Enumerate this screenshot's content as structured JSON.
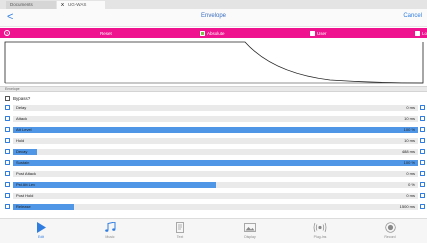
{
  "tabs": {
    "documents": "Documents",
    "active_close": "X",
    "active_label": "UG-WAS"
  },
  "navbar": {
    "back": "<",
    "title": "Envelope",
    "cancel": "Cancel"
  },
  "toolbar": {
    "help": "?",
    "reset": "Reset",
    "absolute": "Absolute",
    "user": "User",
    "extra": "Lo",
    "absolute_checked": true,
    "accent_color": "#f0138f"
  },
  "section_label": "Envelope",
  "bypass": {
    "label": "Bypass?",
    "checked": false
  },
  "params": [
    {
      "name": "Delay",
      "value": "0 ms",
      "fill": 0.0
    },
    {
      "name": "Attack",
      "value": "10 ms",
      "fill": 0.0
    },
    {
      "name": "Att Level",
      "value": "100 %",
      "fill": 1.0
    },
    {
      "name": "Hold",
      "value": "10 ms",
      "fill": 0.0
    },
    {
      "name": "Decay",
      "value": "488 ms",
      "fill": 0.06
    },
    {
      "name": "Sustain",
      "value": "100 %",
      "fill": 1.0
    },
    {
      "name": "Post Attack",
      "value": "0 ms",
      "fill": 0.0
    },
    {
      "name": "Pst Att Lev",
      "value": "0 %",
      "fill": 0.5
    },
    {
      "name": "Post Hold",
      "value": "0 ms",
      "fill": 0.0
    },
    {
      "name": "Release",
      "value": "1500 ms",
      "fill": 0.15
    }
  ],
  "tabbar": [
    {
      "label": "Edit",
      "icon": "play-icon"
    },
    {
      "label": "Music",
      "icon": "music-note-icon"
    },
    {
      "label": "Text",
      "icon": "document-icon"
    },
    {
      "label": "Display",
      "icon": "image-icon"
    },
    {
      "label": "Plug-Ins",
      "icon": "plugin-icon"
    },
    {
      "label": "Record",
      "icon": "record-icon"
    }
  ]
}
